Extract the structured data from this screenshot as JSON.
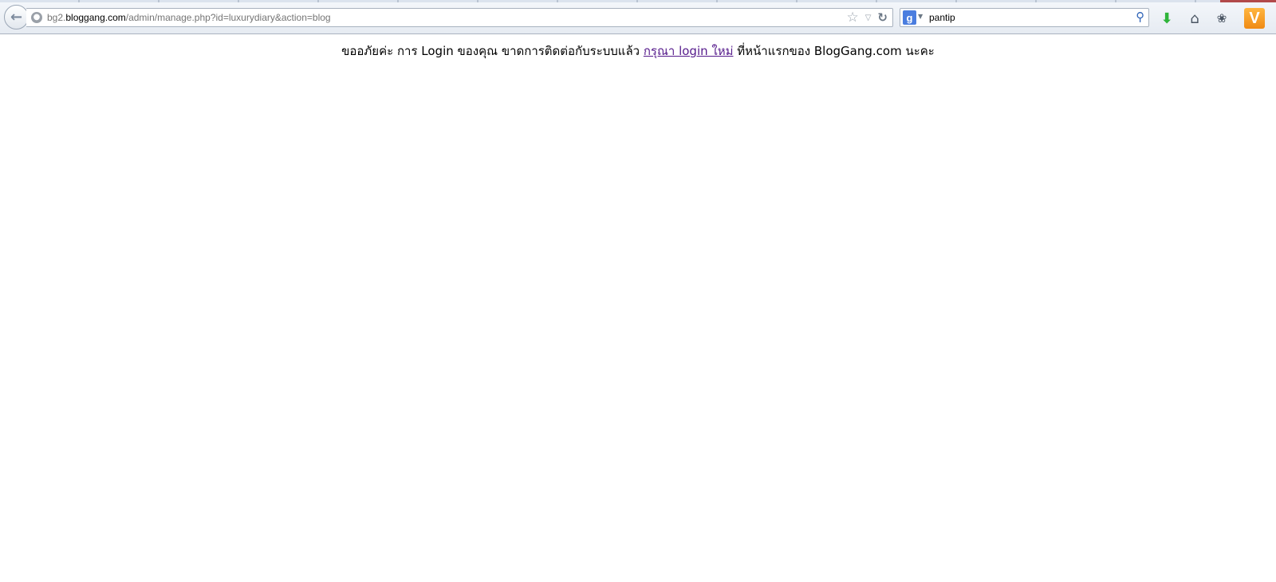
{
  "browser": {
    "url": {
      "prefix": "bg2.",
      "domain": "bloggang.com",
      "path": "/admin/manage.php?id=luxurydiary&action=blog"
    },
    "search": {
      "engine_letter": "g",
      "query": "pantip"
    },
    "icons": {
      "back": "back-arrow-icon",
      "site": "globe-icon",
      "bookmark": "star-icon",
      "history": "dropdown-icon",
      "reload": "reload-icon",
      "search_go": "magnifier-icon",
      "download": "download-arrow-icon",
      "home": "home-icon",
      "addon": "addon-icon",
      "menu": "menu-v-icon"
    },
    "menu_letter": "V"
  },
  "page": {
    "message_before": "ขออภัยค่ะ การ Login ของคุณ ขาดการติดต่อกับระบบแล้ว ",
    "login_link": "กรุณา login ใหม่",
    "message_after": " ที่หน้าแรกของ BlogGang.com นะคะ"
  },
  "colors": {
    "link_visited": "#551a8b",
    "download_green": "#2fb43a",
    "menu_orange": "#f08a14"
  }
}
